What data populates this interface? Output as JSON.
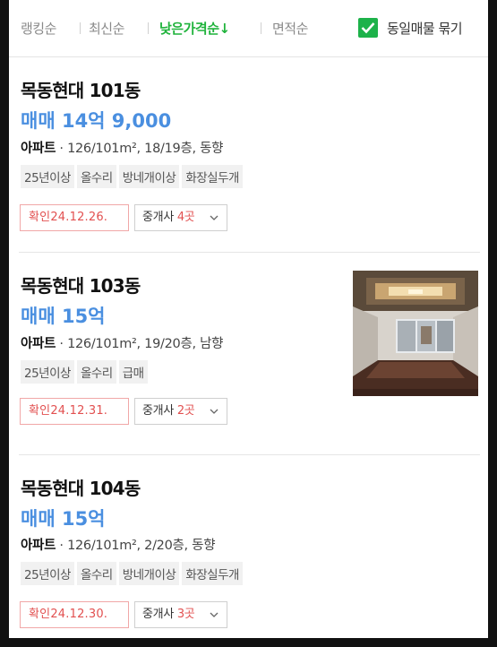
{
  "sort": {
    "items": [
      "랭킹순",
      "최신순",
      "낮은가격순↓",
      "면적순"
    ],
    "active_index": 2,
    "group_label": "동일매물 묶기",
    "group_checked": true
  },
  "listings": [
    {
      "title": "목동현대 101동",
      "price": "매매 14억 9,000",
      "type": "아파트",
      "detail": "126/101m², 18/19층, 동향",
      "tags": [
        "25년이상",
        "올수리",
        "방네개이상",
        "화장실두개"
      ],
      "confirm": "확인24.12.26.",
      "agent_label": "중개사",
      "agent_count": "4곳",
      "has_photo": false
    },
    {
      "title": "목동현대 103동",
      "price": "매매 15억",
      "type": "아파트",
      "detail": "126/101m², 19/20층, 남향",
      "tags": [
        "25년이상",
        "올수리",
        "급매"
      ],
      "confirm": "확인24.12.31.",
      "agent_label": "중개사",
      "agent_count": "2곳",
      "has_photo": true
    },
    {
      "title": "목동현대 104동",
      "price": "매매 15억",
      "type": "아파트",
      "detail": "126/101m², 2/20층, 동향",
      "tags": [
        "25년이상",
        "올수리",
        "방네개이상",
        "화장실두개"
      ],
      "confirm": "확인24.12.30.",
      "agent_label": "중개사",
      "agent_count": "3곳",
      "has_photo": false
    }
  ],
  "colors": {
    "active_sort": "#20b33c",
    "price": "#4a8fe0",
    "confirm": "#e25050",
    "checkbox": "#1db24a"
  }
}
